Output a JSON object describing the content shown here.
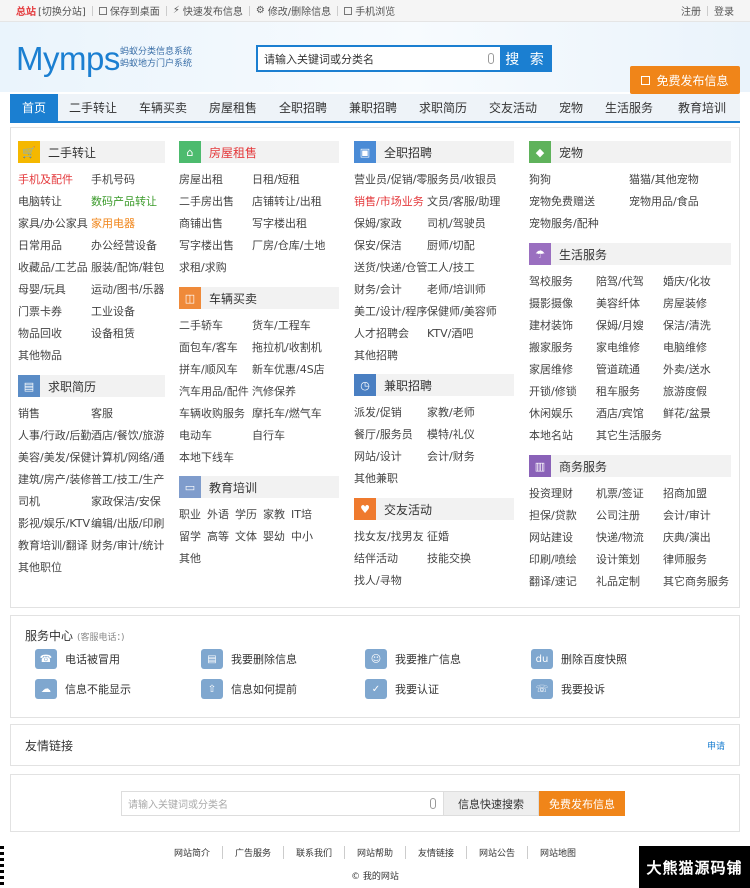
{
  "topbar": {
    "site_name": "总站",
    "switch": "[切换分站]",
    "save_desktop": "保存到桌面",
    "quick_post": "快速发布信息",
    "edit_delete": "修改/删除信息",
    "mobile": "手机浏览",
    "register": "注册",
    "login": "登录"
  },
  "header": {
    "logo": "Mymps",
    "slogan1": "蚂蚁分类信息系统",
    "slogan2": "蚂蚁地方门户系统",
    "search_value": "请输入关键词或分类名",
    "search_button": "搜 索",
    "post_button": "免费发布信息"
  },
  "nav": [
    "首页",
    "二手转让",
    "车辆买卖",
    "房屋租售",
    "全职招聘",
    "兼职招聘",
    "求职简历",
    "交友活动",
    "宠物",
    "生活服务",
    "教育培训"
  ],
  "categories": {
    "secondhand": {
      "title": "二手转让",
      "items": [
        "手机及配件",
        "手机号码",
        "电脑转让",
        "数码产品转让",
        "家具/办公家具",
        "家用电器",
        "日常用品",
        "办公经营设备",
        "收藏品/工艺品",
        "服装/配饰/鞋包",
        "母婴/玩具",
        "运动/图书/乐器",
        "门票卡券",
        "工业设备",
        "物品回收",
        "设备租赁",
        "其他物品"
      ]
    },
    "resume": {
      "title": "求职简历",
      "items": [
        "销售",
        "客服",
        "人事/行政/后勤",
        "酒店/餐饮/旅游",
        "美容/美发/保健/",
        "计算机/网络/通",
        "建筑/房产/装修/",
        "普工/技工/生产",
        "司机",
        "家政保洁/安保",
        "影视/娱乐/KTV",
        "编辑/出版/印刷",
        "教育培训/翻译",
        "财务/审计/统计",
        "其他职位"
      ]
    },
    "house": {
      "title": "房屋租售",
      "items": [
        "房屋出租",
        "日租/短租",
        "二手房出售",
        "店铺转让/出租",
        "商铺出售",
        "写字楼出租",
        "写字楼出售",
        "厂房/仓库/土地",
        "求租/求购"
      ]
    },
    "vehicle": {
      "title": "车辆买卖",
      "items": [
        "二手轿车",
        "货车/工程车",
        "面包车/客车",
        "拖拉机/收割机",
        "拼车/顺风车",
        "新车优惠/4S店",
        "汽车用品/配件",
        "汽修保养",
        "车辆收购服务",
        "摩托车/燃气车",
        "电动车",
        "自行车",
        "本地下线车"
      ]
    },
    "education": {
      "title": "教育培训",
      "items": [
        "职业",
        "外语",
        "学历",
        "家教",
        "IT培",
        "留学",
        "高等",
        "文体",
        "婴幼",
        "中小",
        "其他"
      ]
    },
    "fulltime": {
      "title": "全职招聘",
      "items": [
        "营业员/促销/零",
        "服务员/收银员",
        "销售/市场业务",
        "文员/客服/助理",
        "保姆/家政",
        "司机/驾驶员",
        "保安/保洁",
        "厨师/切配",
        "送货/快递/仓管",
        "工人/技工",
        "财务/会计",
        "老师/培训师",
        "美工/设计/程序",
        "保健师/美容师",
        "人才招聘会",
        "KTV/酒吧",
        "其他招聘"
      ]
    },
    "parttime": {
      "title": "兼职招聘",
      "items": [
        "派发/促销",
        "家教/老师",
        "餐厅/服务员",
        "模特/礼仪",
        "网站/设计",
        "会计/财务",
        "其他兼职"
      ]
    },
    "dating": {
      "title": "交友活动",
      "items": [
        "找女友/找男友",
        "征婚",
        "结伴活动",
        "技能交换",
        "找人/寻物"
      ]
    },
    "pets": {
      "title": "宠物",
      "items": [
        "狗狗",
        "猫猫/其他宠物",
        "宠物免费赠送",
        "宠物用品/食品",
        "宠物服务/配种"
      ]
    },
    "life": {
      "title": "生活服务",
      "items": [
        "驾校服务",
        "陪驾/代驾",
        "婚庆/化妆",
        "摄影摄像",
        "美容纤体",
        "房屋装修",
        "建材装饰",
        "保姆/月嫂",
        "保洁/清洗",
        "搬家服务",
        "家电维修",
        "电脑维修",
        "家居维修",
        "管道疏通",
        "外卖/送水",
        "开锁/修锁",
        "租车服务",
        "旅游度假",
        "休闲娱乐",
        "酒店/宾馆",
        "鲜花/盆景",
        "本地名站",
        "其它生活服务"
      ]
    },
    "business": {
      "title": "商务服务",
      "items": [
        "投资理财",
        "机票/签证",
        "招商加盟",
        "担保/贷款",
        "公司注册",
        "会计/审计",
        "网站建设",
        "快递/物流",
        "庆典/演出",
        "印刷/喷绘",
        "设计策划",
        "律师服务",
        "翻译/速记",
        "礼品定制",
        "其它商务服务"
      ]
    }
  },
  "services": {
    "title": "服务中心",
    "tel": "(客服电话：)",
    "items": [
      "电话被冒用",
      "我要删除信息",
      "我要推广信息",
      "删除百度快照",
      "信息不能显示",
      "信息如何提前",
      "我要认证",
      "我要投诉"
    ]
  },
  "friend": {
    "title": "友情链接",
    "apply": "申请"
  },
  "bottom_search": {
    "placeholder": "请输入关键词或分类名",
    "search_button": "信息快速搜索",
    "post_button": "免费发布信息"
  },
  "footer": {
    "links": [
      "网站简介",
      "广告服务",
      "联系我们",
      "网站帮助",
      "友情链接",
      "网站公告",
      "网站地图"
    ],
    "copyright": "© 我的网站"
  },
  "watermark": "大熊猫源码铺",
  "colors": {
    "primary": "#1b7fd1",
    "accent": "#f08519",
    "red": "#e4393c"
  }
}
